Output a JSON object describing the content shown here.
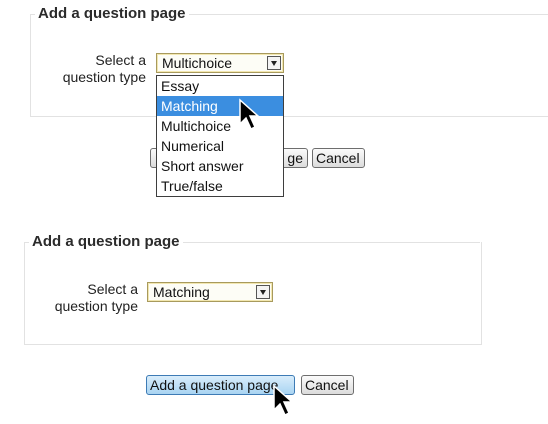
{
  "top": {
    "legend": "Add a question page",
    "select_label_line1": "Select a",
    "select_label_line2": "question type",
    "select_value": "Multichoice",
    "dropdown_options": [
      "Essay",
      "Matching",
      "Multichoice",
      "Numerical",
      "Short answer",
      "True/false"
    ],
    "highlighted_option": "Matching",
    "add_button_partial": "ge",
    "cancel_label": "Cancel"
  },
  "bottom": {
    "legend": "Add a question page",
    "select_label_line1": "Select a",
    "select_label_line2": "question type",
    "select_value": "Matching",
    "add_button_label": "Add a question page",
    "cancel_label": "Cancel"
  },
  "colors": {
    "highlight": "#3b8ee0",
    "focused_button": "#a9d4f2"
  },
  "icons": [
    "chevron-down-icon",
    "mouse-pointer-icon"
  ]
}
